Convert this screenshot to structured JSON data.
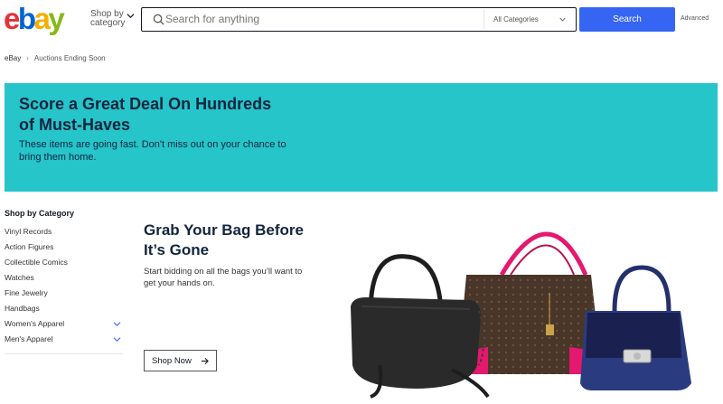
{
  "header": {
    "logo": {
      "letters": [
        "e",
        "b",
        "a",
        "y"
      ],
      "colors": [
        "#e53238",
        "#0064d2",
        "#f5af02",
        "#86b817"
      ]
    },
    "shop_by_line1": "Shop by",
    "shop_by_line2": "category",
    "search_placeholder": "Search for anything",
    "category_select": "All Categories",
    "search_button": "Search",
    "advanced_link": "Advanced"
  },
  "breadcrumb": {
    "home": "eBay",
    "current": "Auctions Ending Soon"
  },
  "banner": {
    "title": "Score a Great Deal On Hundreds of Must-Haves",
    "subtitle": "These items are going fast. Don't miss out on your chance to bring them home.",
    "background": "#25c5ca"
  },
  "sidebar": {
    "title": "Shop by Category",
    "items": [
      {
        "label": "Vinyl Records",
        "expandable": false
      },
      {
        "label": "Action Figures",
        "expandable": false
      },
      {
        "label": "Collectible Comics",
        "expandable": false
      },
      {
        "label": "Watches",
        "expandable": false
      },
      {
        "label": "Fine Jewelry",
        "expandable": false
      },
      {
        "label": "Handbags",
        "expandable": false
      },
      {
        "label": "Women's Apparel",
        "expandable": true
      },
      {
        "label": "Men's Apparel",
        "expandable": true
      }
    ]
  },
  "promo": {
    "title": "Grab Your Bag Before It’s Gone",
    "subtitle": "Start bidding on all the bags you’ll want to get your hands on.",
    "button": "Shop Now",
    "image_icon": "handbags-image"
  },
  "colors": {
    "accent": "#3665f3",
    "banner_text": "#13243d"
  }
}
